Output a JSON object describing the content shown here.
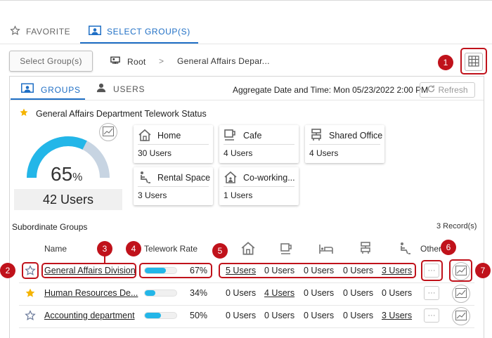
{
  "top_tabs": [
    {
      "label": "FAVORITE",
      "icon": "star-outline-icon"
    },
    {
      "label": "SELECT GROUP(S)",
      "icon": "group-select-icon"
    }
  ],
  "select_button_label": "Select Group(s)",
  "breadcrumb": {
    "root": "Root",
    "separator": ">",
    "current": "General Affairs Depar..."
  },
  "sub_tabs": [
    {
      "label": "GROUPS",
      "icon": "groups-icon"
    },
    {
      "label": "USERS",
      "icon": "user-icon"
    }
  ],
  "aggregate_text": "Aggregate Date and Time: Mon 05/23/2022 2:00 PM",
  "refresh_label": "Refresh",
  "status_title": "General Affairs Department Telework Status",
  "gauge": {
    "percent": 65,
    "percent_text": "65",
    "percent_unit": "%",
    "users_text": "42 Users",
    "fill_color": "#23b6e8",
    "track_color": "#c7d4e2"
  },
  "locations": [
    {
      "label": "Home",
      "value": "30 Users",
      "icon": "home-icon"
    },
    {
      "label": "Cafe",
      "value": "4 Users",
      "icon": "cafe-icon"
    },
    {
      "label": "Shared Office",
      "value": "4 Users",
      "icon": "shared-office-icon"
    },
    {
      "label": "Rental Space",
      "value": "3 Users",
      "icon": "rental-space-icon"
    },
    {
      "label": "Co-working...",
      "value": "1 Users",
      "icon": "coworking-icon"
    }
  ],
  "subordinate": {
    "title": "Subordinate Groups",
    "records": "3 Record(s)",
    "headers": {
      "name": "Name",
      "rate": "Telework Rate",
      "other": "Other"
    },
    "column_icons": [
      "home-icon",
      "cafe-icon",
      "rental-bed-icon",
      "shared-office-icon",
      "rental-space-icon"
    ],
    "rows": [
      {
        "name": "General Affairs Division",
        "favorite": false,
        "rate": 67,
        "rate_text": "67%",
        "counts": [
          "5 Users",
          "0 Users",
          "0 Users",
          "0 Users",
          "3 Users"
        ],
        "linked": [
          true,
          false,
          false,
          false,
          true
        ]
      },
      {
        "name": "Human Resources De...",
        "favorite": true,
        "rate": 34,
        "rate_text": "34%",
        "counts": [
          "0 Users",
          "4 Users",
          "0 Users",
          "0 Users",
          "0 Users"
        ],
        "linked": [
          false,
          true,
          false,
          false,
          false
        ]
      },
      {
        "name": "Accounting department",
        "favorite": false,
        "rate": 50,
        "rate_text": "50%",
        "counts": [
          "0 Users",
          "0 Users",
          "0 Users",
          "0 Users",
          "3 Users"
        ],
        "linked": [
          false,
          false,
          false,
          false,
          true
        ]
      }
    ],
    "more_label": "···"
  },
  "callouts": [
    "1",
    "2",
    "3",
    "4",
    "5",
    "6",
    "7"
  ],
  "colors": {
    "accent": "#1f6fc5",
    "callout": "#c0121b",
    "star": "#f5b400",
    "bar": "#23b6e8"
  }
}
